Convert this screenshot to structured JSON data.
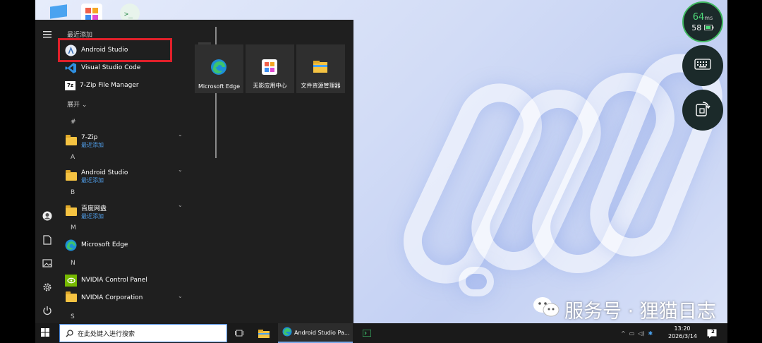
{
  "start_menu": {
    "recent_header": "最近添加",
    "recent": [
      {
        "name": "Android Studio",
        "icon": "android-studio-icon"
      },
      {
        "name": "Visual Studio Code",
        "icon": "vscode-icon"
      },
      {
        "name": "7-Zip File Manager",
        "icon": "7zip-icon"
      }
    ],
    "expand_label": "展开",
    "sections": [
      {
        "letter": "#"
      },
      {
        "letter": "A"
      },
      {
        "letter": "B"
      },
      {
        "letter": "M"
      },
      {
        "letter": "N"
      },
      {
        "letter": "S"
      }
    ],
    "folders": [
      {
        "name": "7-Zip",
        "sub": "最近添加"
      },
      {
        "name": "Android Studio",
        "sub": "最近添加"
      },
      {
        "name": "百度网盘",
        "sub": "最近添加"
      }
    ],
    "apps": [
      {
        "name": "Microsoft Edge"
      },
      {
        "name": "NVIDIA Control Panel"
      },
      {
        "name": "NVIDIA Corporation"
      }
    ],
    "tiles": [
      {
        "label": "Microsoft Edge"
      },
      {
        "label": "无影应用中心"
      },
      {
        "label": "文件资源管理器"
      }
    ]
  },
  "taskbar": {
    "search_placeholder": "在此处键入进行搜索",
    "active_app": "Android Studio Pa...",
    "time": "13:20",
    "date": "2026/3/14",
    "notification_count": "2"
  },
  "overlay": {
    "latency_value": "64",
    "latency_unit": "ms",
    "battery_value": "58"
  },
  "watermark": "服务号 · 狸猫日志"
}
